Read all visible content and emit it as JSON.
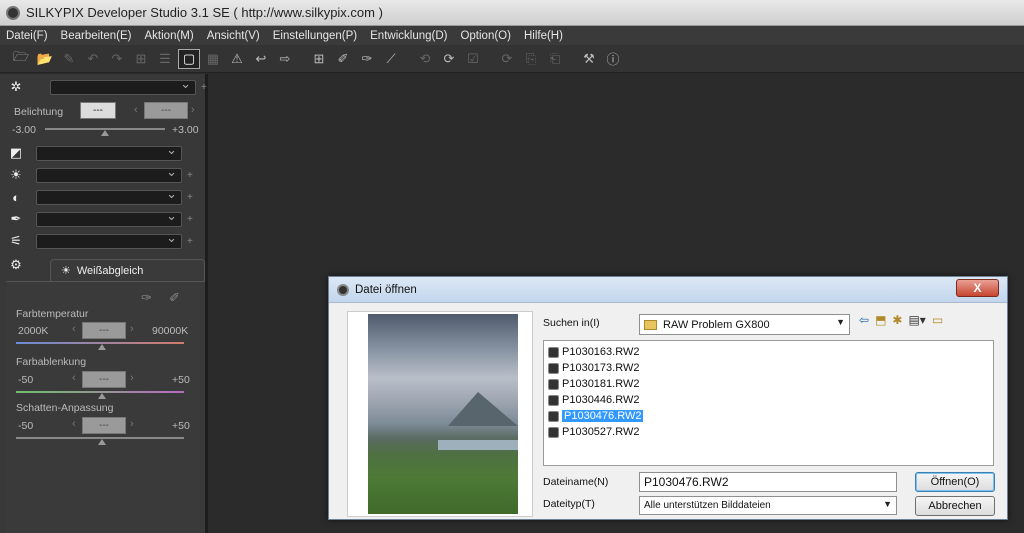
{
  "window": {
    "title": "SILKYPIX Developer Studio 3.1 SE ( http://www.silkypix.com )"
  },
  "menu": [
    "Datei(F)",
    "Bearbeiten(E)",
    "Aktion(M)",
    "Ansicht(V)",
    "Einstellungen(P)",
    "Entwicklung(D)",
    "Option(O)",
    "Hilfe(H)"
  ],
  "panel": {
    "exposure_label": "Belichtung",
    "exposure_value": "---",
    "exposure_value2": "---",
    "exposure_min": "-3.00",
    "exposure_max": "+3.00",
    "wb_tab": "Weißabgleich",
    "color_temp_label": "Farbtemperatur",
    "color_temp_min": "2000K",
    "color_temp_max": "90000K",
    "color_temp_value": "---",
    "tint_label": "Farbablenkung",
    "tint_min": "-50",
    "tint_max": "+50",
    "tint_value": "---",
    "shadow_label": "Schatten-Anpassung",
    "shadow_min": "-50",
    "shadow_max": "+50",
    "shadow_value": "---"
  },
  "dialog": {
    "title": "Datei öffnen",
    "close": "X",
    "look_in_label": "Suchen in(I)",
    "look_in_value": "RAW Problem GX800",
    "files": [
      "P1030163.RW2",
      "P1030173.RW2",
      "P1030181.RW2",
      "P1030446.RW2",
      "P1030476.RW2",
      "P1030527.RW2"
    ],
    "selected_file": "P1030476.RW2",
    "filename_label": "Dateiname(N)",
    "filename_value": "P1030476.RW2",
    "filetype_label": "Dateityp(T)",
    "filetype_value": "Alle unterstützen Bilddateien",
    "open_button": "Öffnen(O)",
    "cancel_button": "Abbrechen"
  }
}
